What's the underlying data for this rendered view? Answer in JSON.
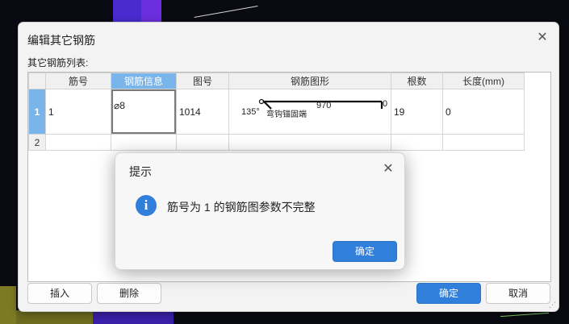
{
  "dialog": {
    "title": "编辑其它钢筋",
    "close_glyph": "✕",
    "list_label": "其它钢筋列表:",
    "columns": [
      "筋号",
      "钢筋信息",
      "图号",
      "钢筋图形",
      "根数",
      "长度(mm)"
    ],
    "active_column": "钢筋信息",
    "rows": [
      {
        "num": "1",
        "bar_no": "1",
        "bar_info": "⌀8",
        "figure_no": "1014",
        "shape": {
          "length": "970",
          "angle": "135°",
          "hook": "弯钩锚固端",
          "end_value": "0"
        },
        "count": "19",
        "length": "0"
      },
      {
        "num": "2",
        "bar_no": "",
        "bar_info": "",
        "figure_no": "",
        "count": "",
        "length": ""
      }
    ],
    "buttons": {
      "insert": "插入",
      "delete": "删除",
      "ok": "确定",
      "cancel": "取消"
    }
  },
  "message": {
    "title": "提示",
    "icon": "info-icon",
    "icon_glyph": "i",
    "close_glyph": "✕",
    "text": "筋号为 1 的钢筋图参数不完整",
    "ok": "确定"
  },
  "colors": {
    "accent": "#2f7fdb",
    "active_header": "#79b5ea"
  }
}
